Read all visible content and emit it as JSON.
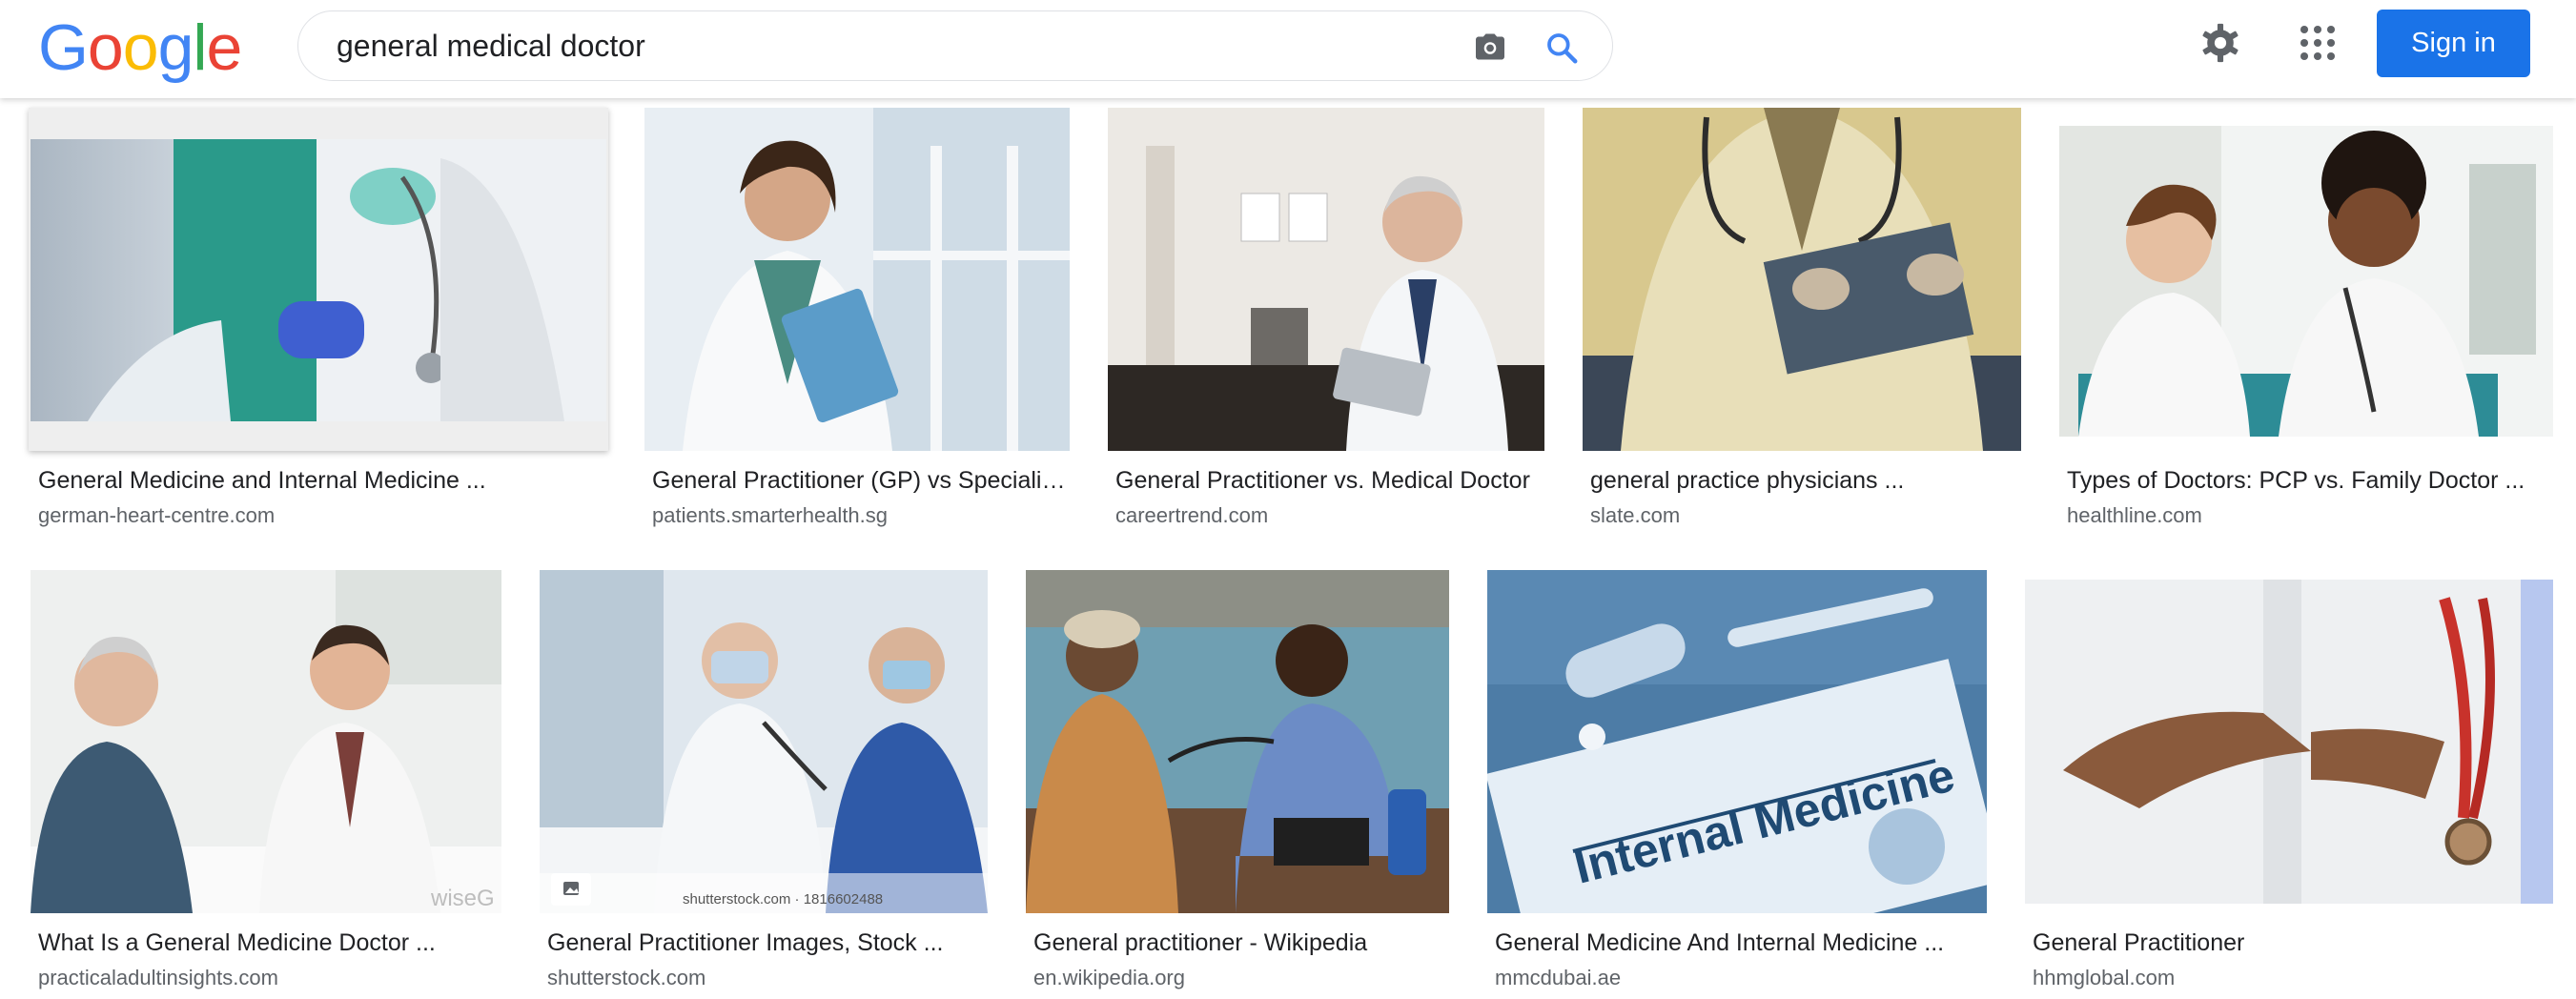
{
  "logo": {
    "text": "Google",
    "letters": [
      "G",
      "o",
      "o",
      "g",
      "l",
      "e"
    ],
    "colors": [
      "#4285F4",
      "#EA4335",
      "#FBBC05",
      "#4285F4",
      "#34A853",
      "#EA4335"
    ]
  },
  "search": {
    "query": "general medical doctor"
  },
  "header": {
    "sign_in_label": "Sign in",
    "icons": [
      "camera-icon",
      "search-icon",
      "gear-icon",
      "apps-icon"
    ]
  },
  "results": [
    {
      "caption": "General Medicine and Internal Medicine ...",
      "source": "german-heart-centre.com"
    },
    {
      "caption": "General Practitioner (GP) vs Specialis...",
      "source": "patients.smarterhealth.sg"
    },
    {
      "caption": "General Practitioner vs. Medical Doctor",
      "source": "careertrend.com"
    },
    {
      "caption": "general practice physicians ...",
      "source": "slate.com"
    },
    {
      "caption": "Types of Doctors: PCP vs. Family Doctor ...",
      "source": "healthline.com"
    },
    {
      "caption": "What Is a General Medicine Doctor ...",
      "source": "practicaladultinsights.com"
    },
    {
      "caption": "General Practitioner Images, Stock ...",
      "source": "shutterstock.com"
    },
    {
      "caption": "General practitioner - Wikipedia",
      "source": "en.wikipedia.org"
    },
    {
      "caption": "General Medicine And Internal Medicine ...",
      "source": "mmcdubai.ae"
    },
    {
      "caption": "General Practitioner",
      "source": "hhmglobal.com"
    }
  ],
  "image_text": {
    "watermark_3": "wiseG",
    "stock_credit": "shutterstock.com · 1816602488",
    "card_headline": "Internal Medicine"
  }
}
